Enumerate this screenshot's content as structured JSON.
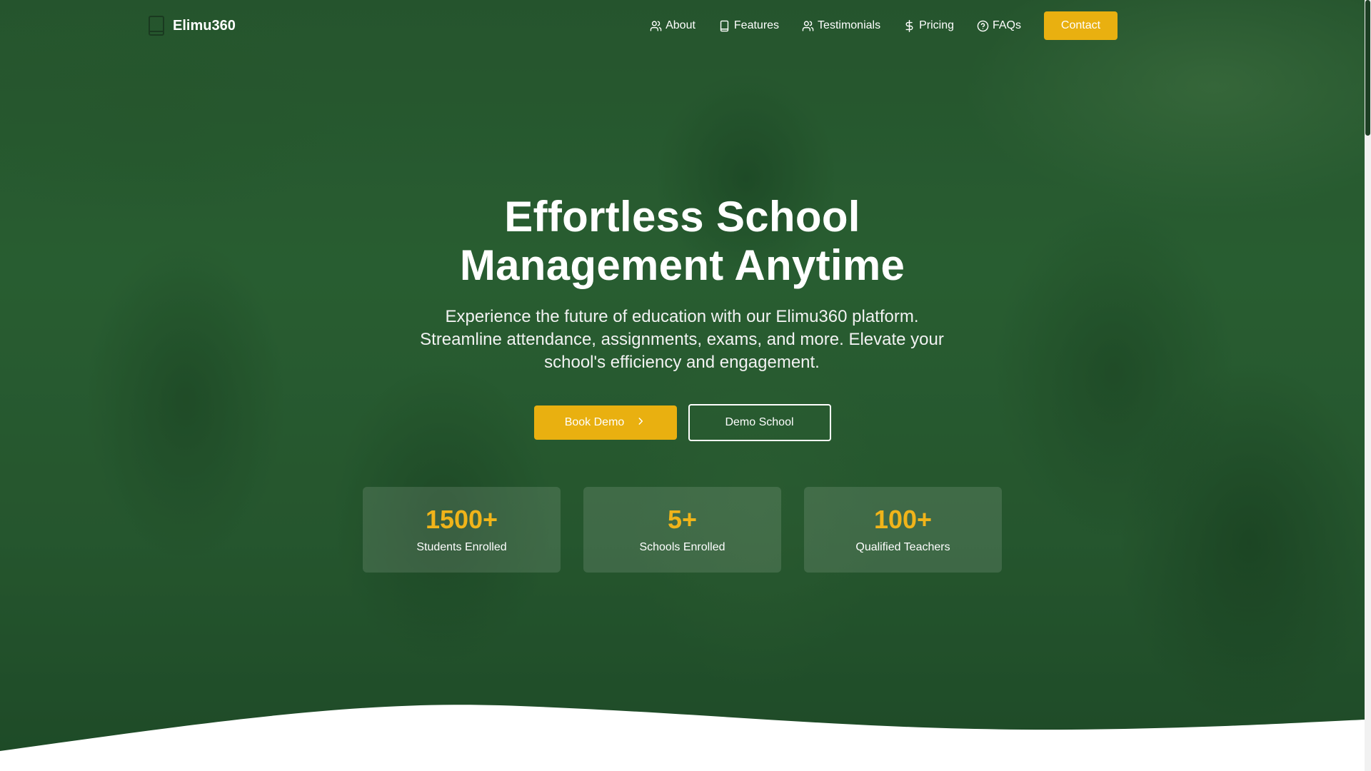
{
  "brand": {
    "name": "Elimu360",
    "logo_icon": "book-icon"
  },
  "nav": {
    "items": [
      {
        "label": "About",
        "icon": "users-icon"
      },
      {
        "label": "Features",
        "icon": "book-icon"
      },
      {
        "label": "Testimonials",
        "icon": "users-icon"
      },
      {
        "label": "Pricing",
        "icon": "dollar-icon"
      },
      {
        "label": "FAQs",
        "icon": "help-circle-icon"
      }
    ],
    "contact_label": "Contact"
  },
  "hero": {
    "title_line1": "Effortless School",
    "title_line2": "Management Anytime",
    "subtitle": "Experience the future of education with our Elimu360 platform. Streamline attendance, assignments, exams, and more. Elevate your school's efficiency and engagement.",
    "primary_cta": "Book Demo",
    "secondary_cta": "Demo School"
  },
  "stats": [
    {
      "value": "1500+",
      "label": "Students Enrolled"
    },
    {
      "value": "5+",
      "label": "Schools Enrolled"
    },
    {
      "value": "100+",
      "label": "Qualified Teachers"
    }
  ],
  "colors": {
    "accent": "#e9b010",
    "stat_value": "#f0b41a",
    "hero_green": "#2f6838",
    "text": "#ffffff"
  }
}
